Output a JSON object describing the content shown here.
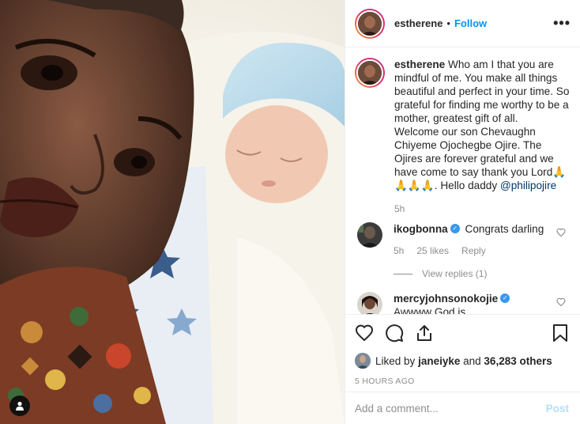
{
  "post": {
    "username": "estherene",
    "follow_label": "Follow",
    "separator": "•",
    "more_label": "•••"
  },
  "caption": {
    "username": "estherene",
    "text": "Who am I that you are mindful of me. You make all things beautiful and perfect in your time. So grateful for finding me worthy to be a mother, greatest gift of all.",
    "text2": "Welcome our son Chevaughn Chiyeme Ojochegbe Ojire. The Ojires are forever grateful and we have come to say thank you Lord",
    "emoji": "🙏🙏🙏🙏",
    "text3": ". Hello daddy",
    "mention": "@philipojire",
    "time": "5h"
  },
  "comments": [
    {
      "username": "ikogbonna",
      "verified": true,
      "text": "Congrats darling",
      "time": "5h",
      "likes": "25 likes",
      "reply_label": "Reply",
      "view_replies": "View replies (1)"
    },
    {
      "username": "mercyjohnsonokojie",
      "verified": true,
      "text": "Awwww God is faithful...congratulations"
    }
  ],
  "likes": {
    "prefix": "Liked by",
    "user": "janeiyke",
    "middle": "and",
    "count": "36,283 others"
  },
  "time_ago": "5 HOURS AGO",
  "add_comment": {
    "placeholder": "Add a comment...",
    "post_label": "Post"
  },
  "icons": {
    "more": "more-options-icon",
    "like": "heart-icon",
    "comment": "comment-icon",
    "share": "share-icon",
    "save": "bookmark-icon",
    "tag": "user-tag-icon"
  }
}
